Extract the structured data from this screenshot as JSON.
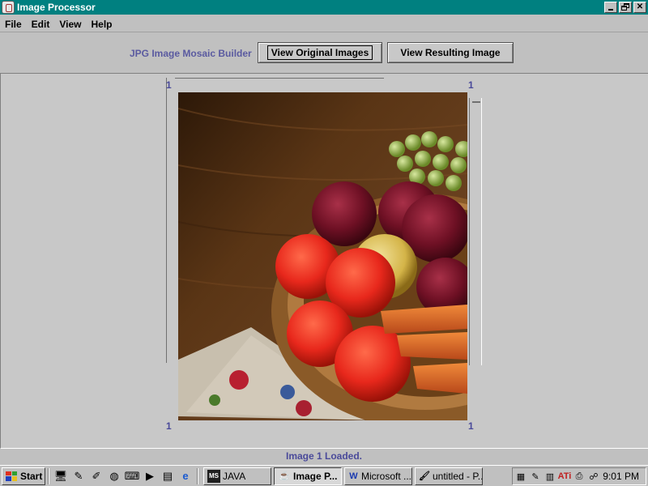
{
  "window": {
    "title": "Image Processor"
  },
  "menu": {
    "file": "File",
    "edit": "Edit",
    "view": "View",
    "help": "Help"
  },
  "toolbar": {
    "app_label": "JPG Image Mosaic Builder",
    "view_original_label": "View Original Images",
    "view_resulting_label": "View Resulting Image"
  },
  "viewer": {
    "index_top_left": "1",
    "index_top_right": "1",
    "index_bottom_left": "1",
    "index_bottom_right": "1"
  },
  "status": {
    "message": "Image 1 Loaded."
  },
  "taskbar": {
    "start_label": "Start",
    "tasks": [
      {
        "label": "JAVA"
      },
      {
        "label": "Image P..."
      },
      {
        "label": "Microsoft ..."
      },
      {
        "label": "untitled - P..."
      }
    ],
    "clock": "9:01 PM"
  },
  "colors": {
    "titlebar": "#008080",
    "label_accent": "#4a4a9a",
    "desktop": "#c0c0c0"
  }
}
